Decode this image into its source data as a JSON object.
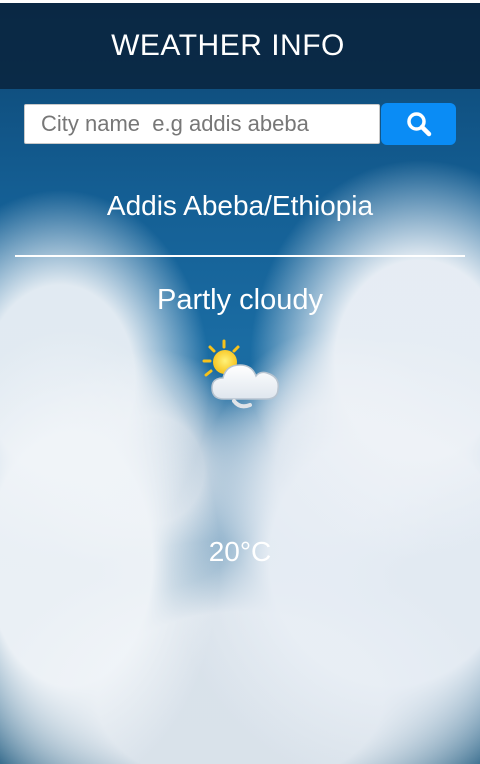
{
  "header": {
    "title": "WEATHER INFO"
  },
  "search": {
    "placeholder": "City name  e.g addis abeba",
    "value": "",
    "icon": "search-icon"
  },
  "weather": {
    "location": "Addis Abeba/Ethiopia",
    "condition": "Partly cloudy",
    "icon": "partly-cloudy-icon",
    "temperature": "20°C"
  },
  "colors": {
    "header_bg": "#0a223a",
    "search_button": "#0a8cf5",
    "text": "#ffffff"
  }
}
